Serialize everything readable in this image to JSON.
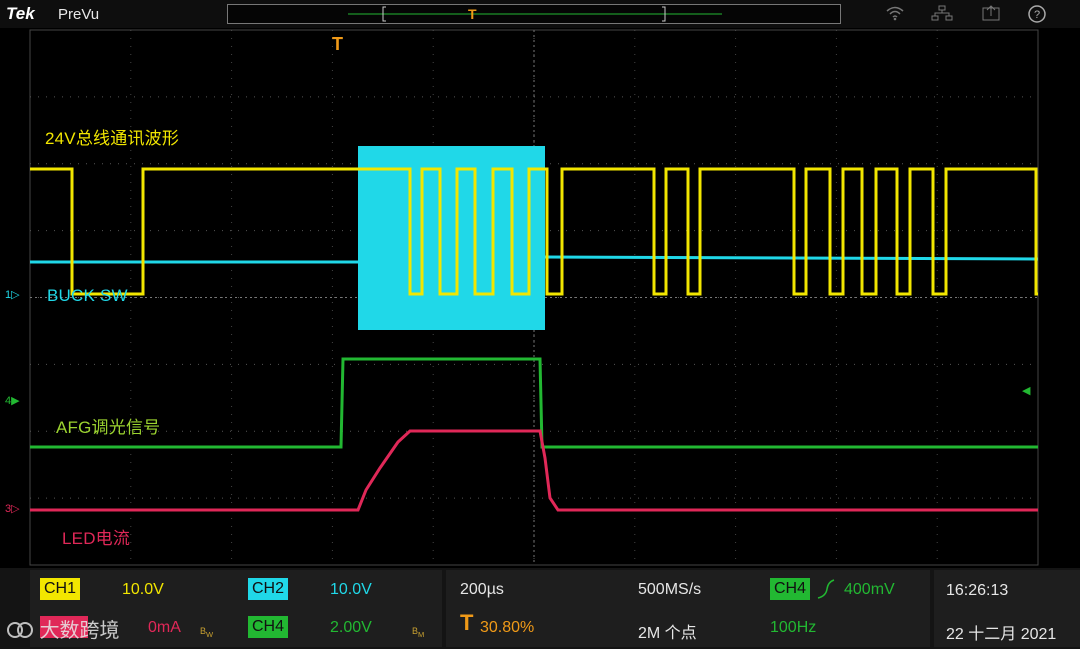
{
  "header": {
    "brand": "Tek",
    "mode": "PreVu"
  },
  "colors": {
    "ch1": "#f2e600",
    "ch2": "#20d8e8",
    "ch3": "#e02858",
    "ch4": "#22b832",
    "trigger": "#f09a18",
    "grid": "#555555"
  },
  "icons": [
    "wifi-icon",
    "network-icon",
    "export-icon",
    "help-icon"
  ],
  "trigger": {
    "marker": "T",
    "position_percent": 30.8
  },
  "traces": {
    "ch1_label": "24V总线通讯波形",
    "ch2_label": "BUCK SW",
    "ch4_label": "AFG调光信号",
    "ch3_label": "LED电流"
  },
  "channel_markers": {
    "ch2": "1",
    "ch4": "4",
    "ch3": "3"
  },
  "readouts": {
    "ch1_badge": "CH1",
    "ch1_scale": "10.0V",
    "ch2_badge": "CH2",
    "ch2_scale": "10.0V",
    "ch3_scale": "0mA",
    "ch4_badge": "CH4",
    "ch4_scale": "2.00V",
    "timebase": "200µs",
    "trigger_icon": "T",
    "trigger_pos": "30.80%",
    "sample_rate": "500MS/s",
    "record_length": "2M 个点",
    "trig_source_badge": "CH4",
    "trig_level": "400mV",
    "trig_freq": "100Hz",
    "time": "16:26:13",
    "date": "22 十二月 2021"
  },
  "watermark": "大数跨境"
}
